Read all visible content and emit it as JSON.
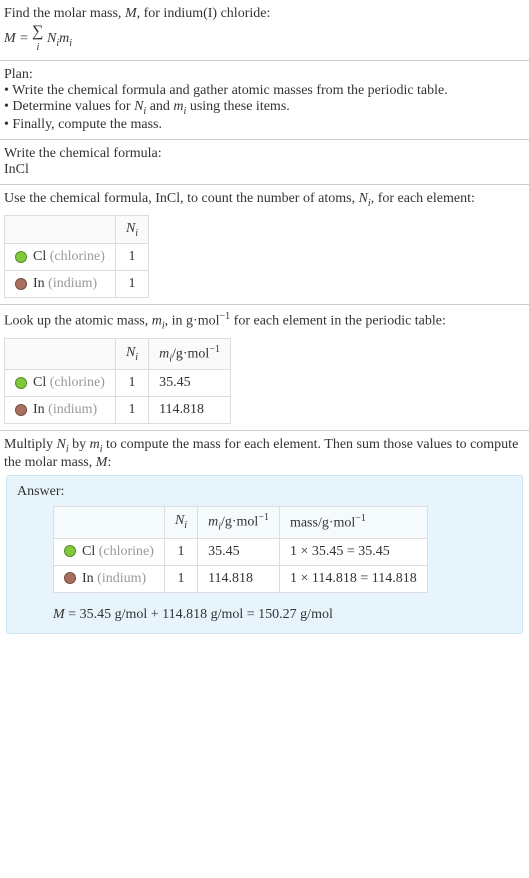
{
  "intro": {
    "line1_prefix": "Find the molar mass, ",
    "line1_var": "M",
    "line1_suffix": ", for indium(I) chloride:",
    "eq_lhs": "M",
    "eq_eq": " = ",
    "eq_sigma": "∑",
    "eq_sigma_sub": "i",
    "eq_rhs1": "N",
    "eq_rhs1_sub": "i",
    "eq_rhs2": "m",
    "eq_rhs2_sub": "i"
  },
  "plan": {
    "header": "Plan:",
    "b1_prefix": "• Write the chemical formula and gather atomic masses from the periodic table.",
    "b2_prefix": "• Determine values for ",
    "b2_n": "N",
    "b2_n_sub": "i",
    "b2_mid": " and ",
    "b2_m": "m",
    "b2_m_sub": "i",
    "b2_suffix": " using these items.",
    "b3": "• Finally, compute the mass."
  },
  "formula_section": {
    "line": "Write the chemical formula:",
    "formula": "InCl"
  },
  "count_section": {
    "text1": "Use the chemical formula, InCl, to count the number of atoms, ",
    "var": "N",
    "var_sub": "i",
    "text2": ", for each element:",
    "header_N": "N",
    "header_N_sub": "i",
    "rows": [
      {
        "sym": "Cl",
        "name": "(chlorine)",
        "n": "1",
        "dot": "cl"
      },
      {
        "sym": "In",
        "name": "(indium)",
        "n": "1",
        "dot": "in"
      }
    ]
  },
  "mass_section": {
    "text1": "Look up the atomic mass, ",
    "var": "m",
    "var_sub": "i",
    "text2": ", in g·mol",
    "text2_sup": "−1",
    "text3": " for each element in the periodic table:",
    "header_N": "N",
    "header_N_sub": "i",
    "header_m": "m",
    "header_m_sub": "i",
    "header_m_unit": "/g·mol",
    "header_m_sup": "−1",
    "rows": [
      {
        "sym": "Cl",
        "name": "(chlorine)",
        "n": "1",
        "m": "35.45",
        "dot": "cl"
      },
      {
        "sym": "In",
        "name": "(indium)",
        "n": "1",
        "m": "114.818",
        "dot": "in"
      }
    ]
  },
  "multiply_section": {
    "t1": "Multiply ",
    "n": "N",
    "n_sub": "i",
    "t2": " by ",
    "m": "m",
    "m_sub": "i",
    "t3": " to compute the mass for each element. Then sum those values to compute the molar mass, ",
    "mv": "M",
    "t4": ":"
  },
  "answer": {
    "label": "Answer:",
    "header_N": "N",
    "header_N_sub": "i",
    "header_m": "m",
    "header_m_sub": "i",
    "header_m_unit": "/g·mol",
    "header_m_sup": "−1",
    "header_mass": "mass/g·mol",
    "header_mass_sup": "−1",
    "rows": [
      {
        "sym": "Cl",
        "name": "(chlorine)",
        "n": "1",
        "m": "35.45",
        "mass": "1 × 35.45 = 35.45",
        "dot": "cl"
      },
      {
        "sym": "In",
        "name": "(indium)",
        "n": "1",
        "m": "114.818",
        "mass": "1 × 114.818 = 114.818",
        "dot": "in"
      }
    ],
    "final_lhs": "M",
    "final_rest": " = 35.45 g/mol + 114.818 g/mol = 150.27 g/mol"
  }
}
